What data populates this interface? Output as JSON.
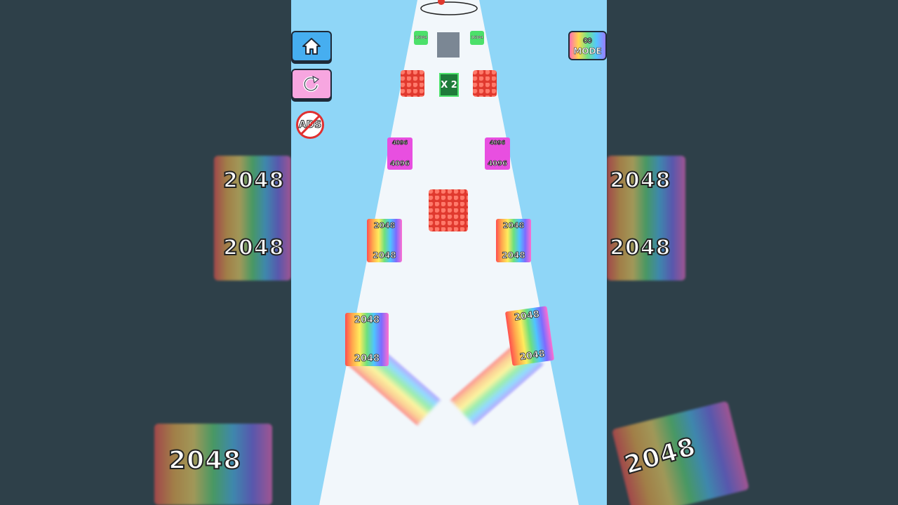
{
  "hud": {
    "home_icon": "home-icon",
    "restart_icon": "restart-icon",
    "ads_label": "ADS",
    "mode_symbol": "∞",
    "mode_label": "MODE"
  },
  "track": {
    "multiplier_label": "X 2",
    "far_pickups": [
      "16384",
      "16384"
    ],
    "pink_cubes": [
      {
        "top": "4096",
        "front": "4096"
      },
      {
        "top": "4096",
        "front": "4096"
      }
    ],
    "rainbow_cubes_mid": [
      {
        "top": "2048",
        "front": "2048"
      },
      {
        "top": "2048",
        "front": "2048"
      }
    ],
    "player_cubes": [
      {
        "top": "2048",
        "front": "2048"
      },
      {
        "top": "2048",
        "front": "2048"
      }
    ]
  },
  "background_blur": {
    "labels": [
      "2048",
      "2048",
      "2048",
      "2048",
      "2048",
      "2048",
      "2048"
    ]
  },
  "colors": {
    "sky": "#8fd6f7",
    "track": "#f2f7fb",
    "side_panels": "#2e4049",
    "spike_red": "#e0392e",
    "pink_cube": "#e84fe0",
    "multiplier_green": "#1f7a3a"
  }
}
